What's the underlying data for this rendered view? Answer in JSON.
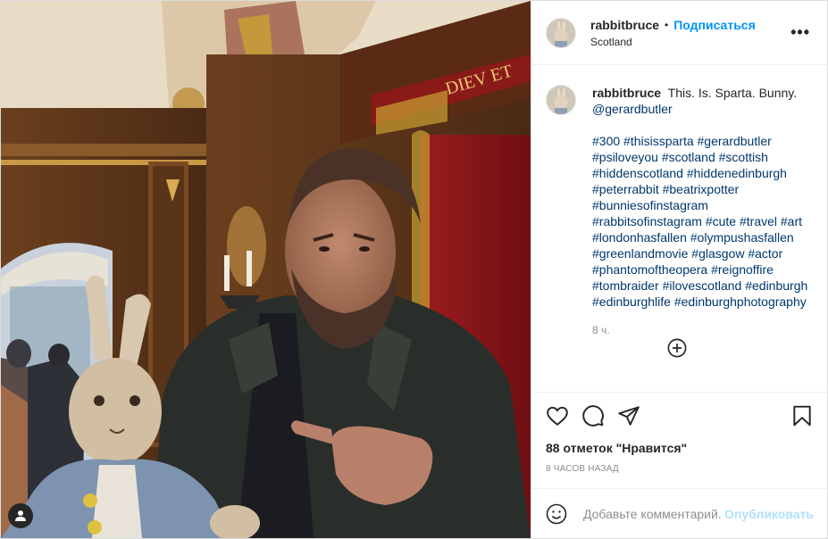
{
  "header": {
    "username": "rabbitbruce",
    "separator": "•",
    "follow_label": "Подписаться",
    "location": "Scotland",
    "more_label": "•••"
  },
  "photo": {
    "sign_text": "DIEV ET"
  },
  "caption": {
    "username": "rabbitbruce",
    "text": "This. Is. Sparta. Bunny.",
    "mention": "@gerardbutler",
    "hashtag_lines": [
      "#300 #thisissparta #gerardbutler",
      "#psiloveyou #scotland #scottish",
      "#hiddenscotland #hiddenedinburgh",
      "#peterrabbit #beatrixpotter",
      "#bunniesofinstagram",
      "#rabbitsofinstagram #cute #travel #art",
      "#londonhasfallen #olympushasfallen",
      "#greenlandmovie #glasgow #actor",
      "#phantomoftheopera #reignoffire",
      "#tombraider #ilovescotland #edinburgh",
      "#edinburghlife #edinburghphotography"
    ],
    "time": "8 ч."
  },
  "actions": {
    "likes_text": "88 отметок \"Нравится\"",
    "time_ago": "8 часов назад"
  },
  "comment_box": {
    "placeholder": "Добавьте комментарий...",
    "publish_label": "Опубликовать"
  },
  "colors": {
    "accent": "#0095f6",
    "link": "#00376b",
    "muted": "#8e8e8e",
    "publish_disabled": "#b2dffc"
  },
  "icons": {
    "like": "heart-icon",
    "comment": "comment-bubble-icon",
    "share": "paper-plane-icon",
    "save": "bookmark-icon",
    "load_more": "plus-circle-icon",
    "emoji": "smiley-icon",
    "user_tag": "user-silhouette-icon",
    "more": "ellipsis-icon"
  }
}
